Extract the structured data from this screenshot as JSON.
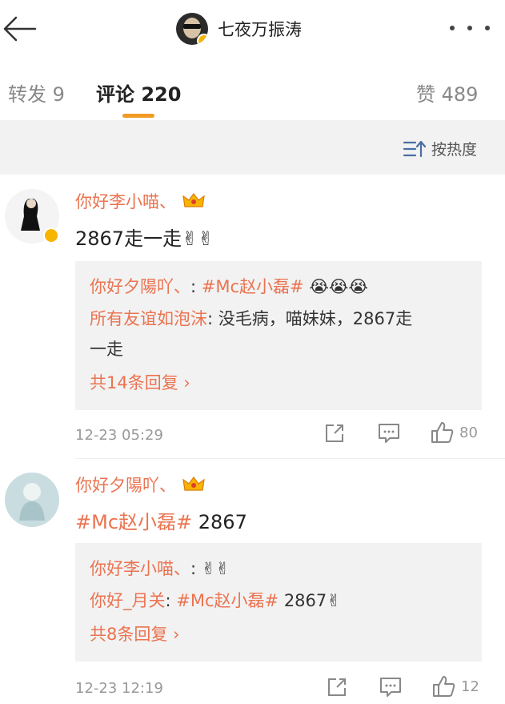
{
  "header": {
    "title": "七夜万振涛"
  },
  "tabs": {
    "repost_label": "转发",
    "repost_count": "9",
    "comments_label": "评论",
    "comments_count": "220",
    "likes_label": "赞",
    "likes_count": "489"
  },
  "sort": {
    "label": "按热度"
  },
  "comments": [
    {
      "author": "你好李小喵、",
      "text": "2867走一走✌✌",
      "replies": [
        {
          "author": "你好夕陽吖、",
          "sep": ":",
          "tag": "#Mc赵小磊#",
          "text": "😭😭😭"
        },
        {
          "author": "所有友谊如泡沫",
          "sep": ":",
          "text": "没毛病，喵妹妹，2867走",
          "text2": "一走"
        }
      ],
      "more_replies": "共14条回复 ›",
      "time": "12-23 05:29",
      "likes": "80"
    },
    {
      "author": "你好夕陽吖、",
      "tag": "#Mc赵小磊#",
      "text": "2867",
      "replies": [
        {
          "author": "你好李小喵、",
          "sep": ":",
          "text": "✌✌"
        },
        {
          "author": "你好_月关",
          "sep": ":",
          "tag": "#Mc赵小磊#",
          "text": "2867✌"
        }
      ],
      "more_replies": "共8条回复 ›",
      "time": "12-23 12:19",
      "likes": "12"
    }
  ]
}
